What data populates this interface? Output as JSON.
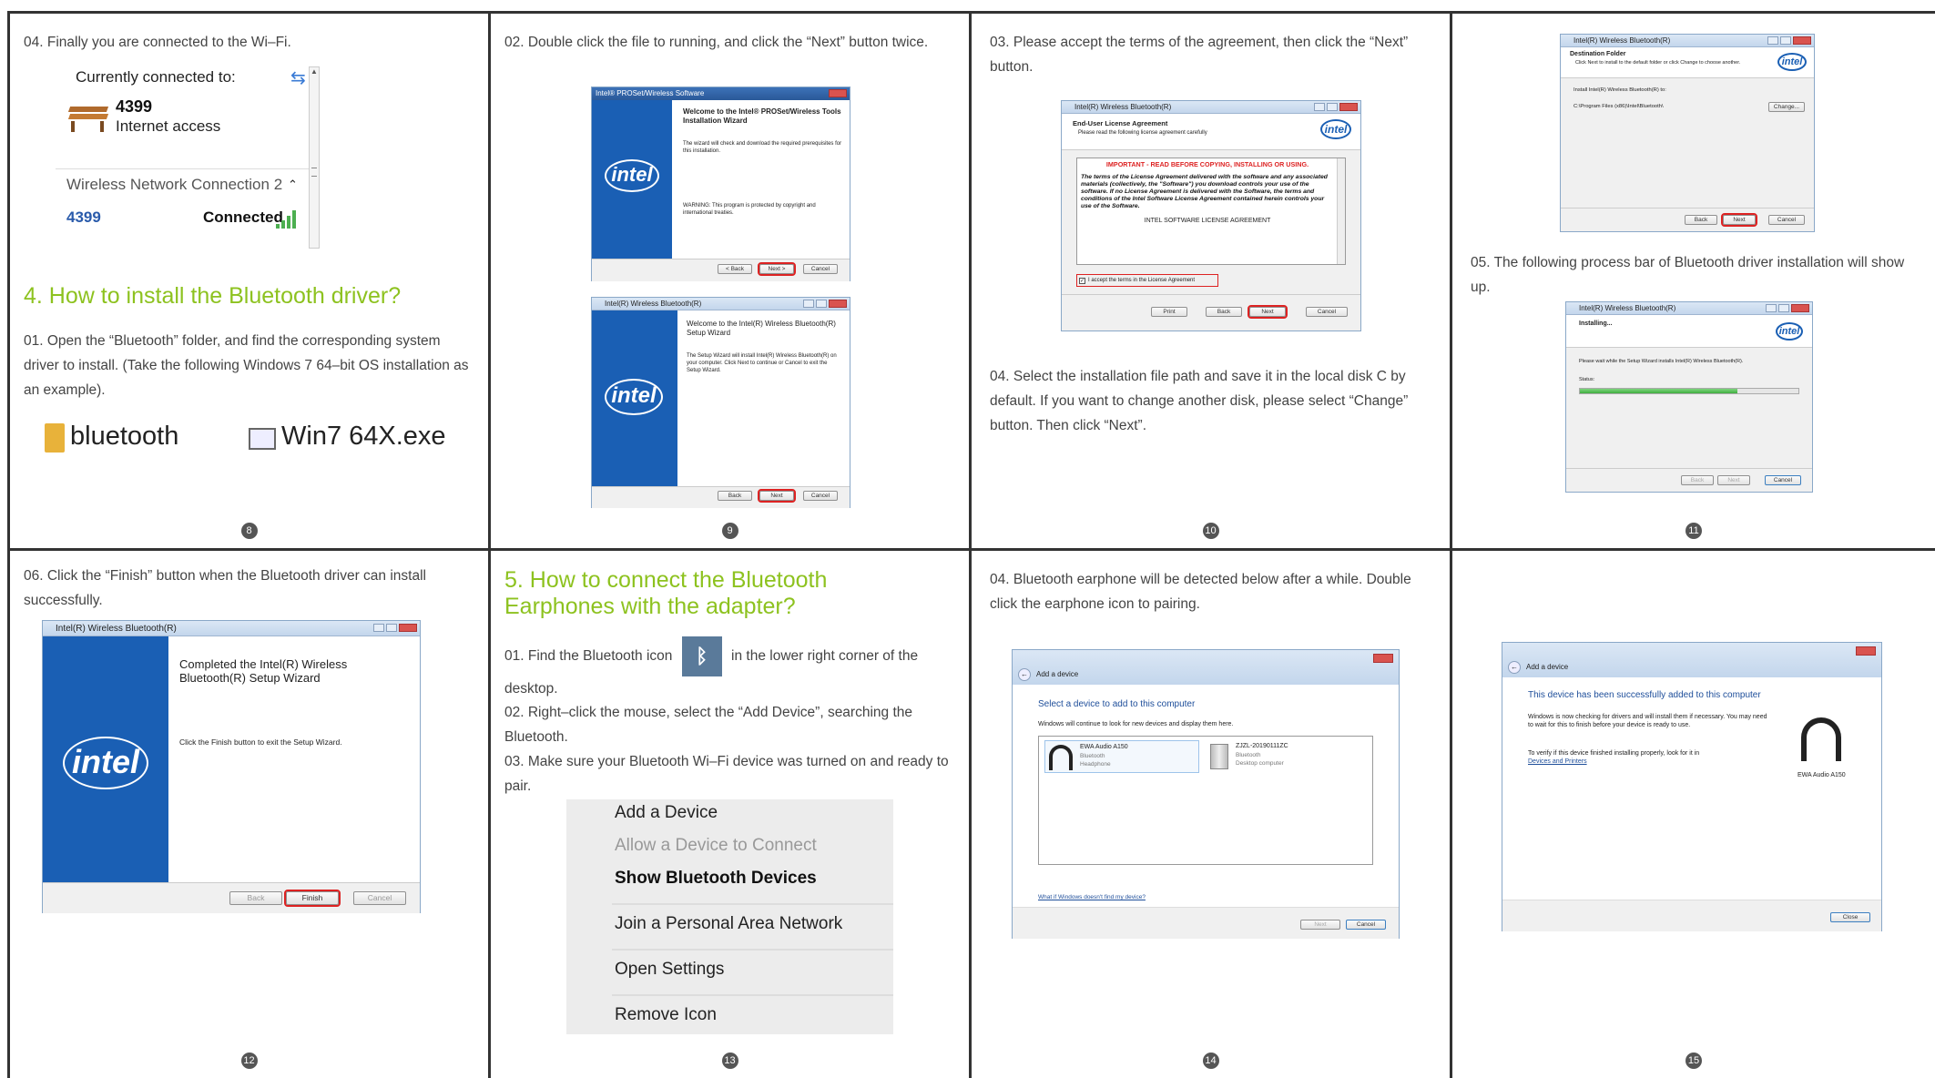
{
  "cells": {
    "c8": {
      "step": "04. Finally you are connected to the Wi–Fi.",
      "currently": "Currently connected to:",
      "net_name": "4399",
      "net_status": "Internet access",
      "section_title": "Wireless Network Connection 2",
      "row_name": "4399",
      "row_status": "Connected",
      "heading": "4. How to install the Bluetooth driver?",
      "para": "01. Open the “Bluetooth” folder, and find the corresponding system driver to install. (Take the following Windows 7 64–bit OS installation as an example).",
      "folder_label": "bluetooth",
      "exe_label": "Win7 64X.exe",
      "page": "8"
    },
    "c9": {
      "step": "02. Double click the file to running, and click the “Next” button twice.",
      "win1_title": "Intel® PROSet/Wireless Software",
      "win1_heading": "Welcome to the Intel® PROSet/Wireless Tools Installation Wizard",
      "win1_body": "The wizard will check and download the required prerequisites for this installation.",
      "win1_warn": "WARNING: This program is protected by copyright and international treaties.",
      "win1_btns": [
        "< Back",
        "Next >",
        "Cancel"
      ],
      "win2_title": "Intel(R) Wireless Bluetooth(R)",
      "win2_heading": "Welcome to the Intel(R) Wireless Bluetooth(R) Setup Wizard",
      "win2_body": "The Setup Wizard will install Intel(R) Wireless Bluetooth(R) on your computer. Click Next to continue or Cancel to exit the Setup Wizard.",
      "win2_btns": [
        "Back",
        "Next",
        "Cancel"
      ],
      "logo": "intel",
      "page": "9"
    },
    "c10": {
      "step": "03. Please accept the terms of the agreement, then click the “Next” button.",
      "win_title": "Intel(R) Wireless Bluetooth(R)",
      "win_heading": "End-User License Agreement",
      "win_sub": "Please read the following license agreement carefully",
      "lic_warn": "IMPORTANT - READ BEFORE COPYING, INSTALLING OR USING.",
      "lic_body": "The terms of the License Agreement delivered with the software and any associated materials (collectively, the \"Software\") you download controls your use of the software. If no License Agreement is delivered with the Software, the terms and conditions of the Intel Software License Agreement contained herein controls your use of the Software.",
      "lic_footer": "INTEL SOFTWARE LICENSE AGREEMENT",
      "accept": "I accept the terms in the License Agreement",
      "btns": [
        "Print",
        "Back",
        "Next",
        "Cancel"
      ],
      "step2": "04.  Select the installation file path and save it in the local disk C by default. If you want to change another disk, please select “Change” button. Then click “Next”.",
      "logo": "intel",
      "page": "10"
    },
    "c11": {
      "win1_title": "Intel(R) Wireless Bluetooth(R)",
      "win1_heading": "Destination Folder",
      "win1_sub": "Click Next to install to the default folder or click Change to choose another.",
      "win1_install": "Install Intel(R) Wireless Bluetooth(R) to:",
      "win1_path": "C:\\Program Files (x86)\\Intel\\Bluetooth\\",
      "win1_change": "Change...",
      "win1_btns": [
        "Back",
        "Next",
        "Cancel"
      ],
      "step": "05. The following process bar of Bluetooth driver installation will show up.",
      "win2_title": "Intel(R) Wireless Bluetooth(R)",
      "win2_heading": "Installing...",
      "win2_body": "Please wait while the Setup Wizard installs Intel(R) Wireless Bluetooth(R).",
      "win2_status": "Status:",
      "win2_progress": 0.72,
      "win2_btns": [
        "Back",
        "Next",
        "Cancel"
      ],
      "logo": "intel",
      "page": "11"
    },
    "c12": {
      "step": "06. Click the “Finish” button when the Bluetooth driver can install successfully.",
      "win_title": "Intel(R) Wireless Bluetooth(R)",
      "win_heading": "Completed the Intel(R) Wireless Bluetooth(R) Setup Wizard",
      "win_body": "Click the Finish button to exit the Setup Wizard.",
      "btns": [
        "Back",
        "Finish",
        "Cancel"
      ],
      "logo": "intel",
      "page": "12"
    },
    "c13": {
      "heading": "5. How to connect the Bluetooth Earphones with the adapter?",
      "s1a": "01. Find the Bluetooth icon",
      "s1b": "in the lower right corner of the desktop.",
      "s2": "02.  Right–click the mouse, select the “Add Device”, searching the Bluetooth.",
      "s3": "03.  Make sure your Bluetooth Wi–Fi device was turned on and ready to pair.",
      "menu": [
        "Add a Device",
        "Allow a Device to Connect",
        "Show Bluetooth Devices",
        "Join a Personal Area Network",
        "Open Settings",
        "Remove Icon"
      ],
      "page": "13"
    },
    "c14": {
      "step": "04. Bluetooth earphone will be detected below after a while. Double click the earphone icon to pairing.",
      "win_title": "Add a device",
      "win_heading": "Select a device to add to this computer",
      "win_sub": "Windows will continue to look for new devices and display them here.",
      "dev1": [
        "EWA Audio A150",
        "Bluetooth",
        "Headphone"
      ],
      "dev2": [
        "ZJZL-20190111ZC",
        "Bluetooth",
        "Desktop computer"
      ],
      "link": "What if Windows doesn't find my device?",
      "btns": [
        "Next",
        "Cancel"
      ],
      "page": "14"
    },
    "c15": {
      "win_title": "Add a device",
      "win_heading": "This device has been successfully added to this computer",
      "win_body": "Windows is now checking for drivers and will install them if necessary. You may need to wait for this to finish before your device is ready to use.",
      "win_verify": "To verify if this device finished installing properly, look for it in",
      "win_link": "Devices and Printers",
      "device": "EWA Audio A150",
      "close": "Close",
      "page": "15"
    }
  }
}
